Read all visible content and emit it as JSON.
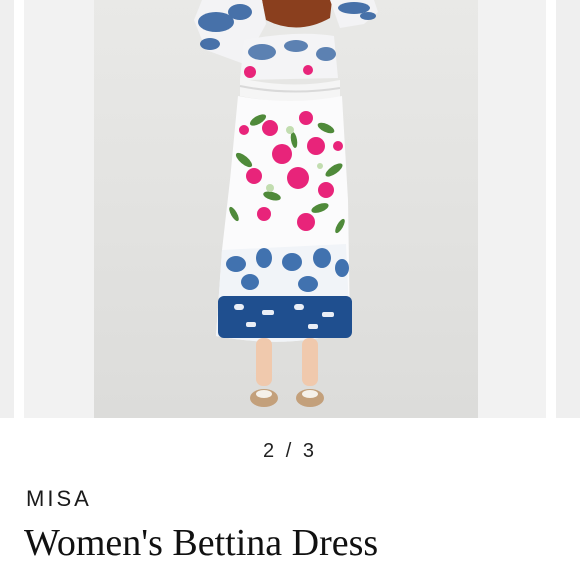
{
  "gallery": {
    "current_page": 2,
    "total_pages": 3,
    "indicator": "2 / 3"
  },
  "product": {
    "brand": "MISA",
    "title": "Women's Bettina Dress"
  },
  "colors": {
    "tie_dye_blue": "#1f4f8f",
    "floral_pink": "#e8247a",
    "leaf_green": "#4f8a3a",
    "background_gray": "#e6e6e4"
  }
}
